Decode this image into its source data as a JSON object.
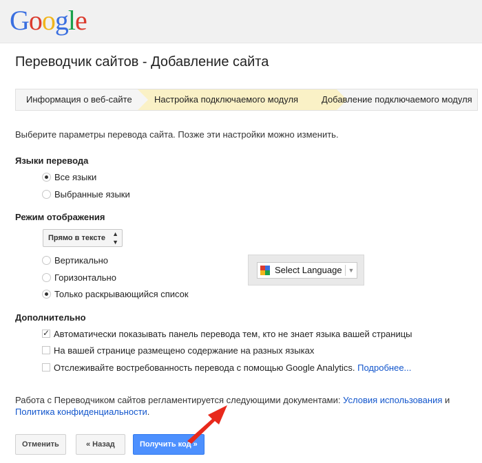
{
  "header": {
    "logo_letters": [
      "G",
      "o",
      "o",
      "g",
      "l",
      "e"
    ]
  },
  "page": {
    "title": "Переводчик сайтов - Добавление сайта"
  },
  "steps": [
    {
      "label": "Информация о веб-сайте",
      "active": false
    },
    {
      "label": "Настройка подключаемого модуля",
      "active": true
    },
    {
      "label": "Добавление подключаемого модуля",
      "active": false
    }
  ],
  "intro": "Выберите параметры перевода сайта. Позже эти настройки можно изменить.",
  "languages": {
    "heading": "Языки перевода",
    "options": [
      {
        "label": "Все языки",
        "selected": true
      },
      {
        "label": "Выбранные языки",
        "selected": false
      }
    ]
  },
  "display": {
    "heading": "Режим отображения",
    "select_value": "Прямо в тексте",
    "options": [
      {
        "label": "Вертикально",
        "selected": false
      },
      {
        "label": "Горизонтально",
        "selected": false
      },
      {
        "label": "Только раскрывающийся список",
        "selected": true
      }
    ],
    "preview_label": "Select Language"
  },
  "advanced": {
    "heading": "Дополнительно",
    "options": [
      {
        "label": "Автоматически показывать панель перевода тем, кто не знает языка вашей страницы",
        "checked": true
      },
      {
        "label": "На вашей странице размещено содержание на разных языках",
        "checked": false
      },
      {
        "label": "Отслеживайте востребованность перевода с помощью Google Analytics.",
        "checked": false,
        "link": "Подробнее..."
      }
    ]
  },
  "footer": {
    "text_before": "Работа с Переводчиком сайтов регламентируется следующими документами:",
    "link1": "Условия использования",
    "and": "и",
    "link2": "Политика конфиденциальности",
    "end": "."
  },
  "buttons": {
    "cancel": "Отменить",
    "back": "« Назад",
    "get_code": "Получить код »"
  },
  "colors": {
    "accent_blue": "#4d90fe",
    "link": "#1155cc",
    "active_step": "#faf1c6",
    "arrow": "#e8291c"
  }
}
